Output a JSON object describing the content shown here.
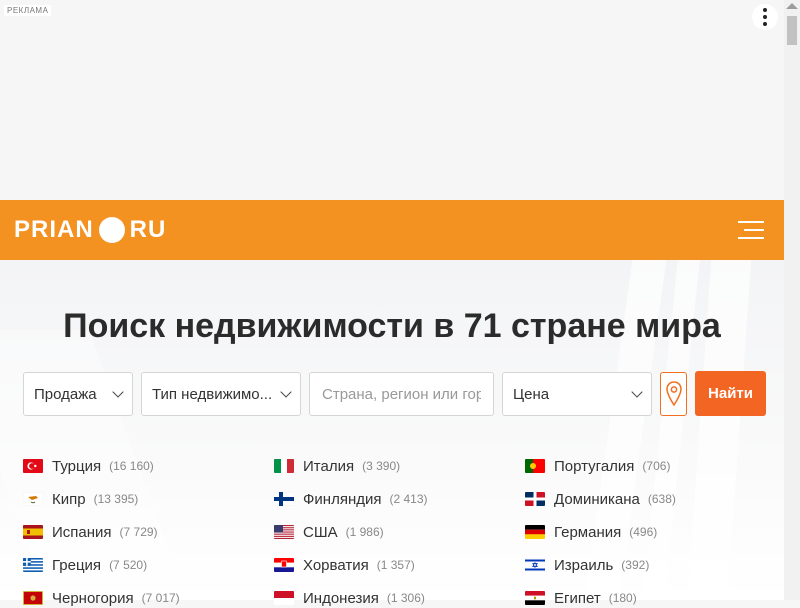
{
  "ad": {
    "label": "РЕКЛАМА"
  },
  "header": {
    "logo_left": "PRIAN",
    "logo_right": "RU"
  },
  "hero": {
    "title": "Поиск недвижимости в 71 стране мира"
  },
  "search": {
    "deal_type": "Продажа",
    "property_type": "Тип недвижимо...",
    "location_placeholder": "Страна, регион или город",
    "price": "Цена",
    "find_label": "Найти"
  },
  "countries": [
    {
      "name": "Турция",
      "count": "(16 160)",
      "flag": "turkey-flag-icon"
    },
    {
      "name": "Италия",
      "count": "(3 390)",
      "flag": "italy-flag-icon"
    },
    {
      "name": "Португалия",
      "count": "(706)",
      "flag": "portugal-flag-icon"
    },
    {
      "name": "Кипр",
      "count": "(13 395)",
      "flag": "cyprus-flag-icon"
    },
    {
      "name": "Финляндия",
      "count": "(2 413)",
      "flag": "finland-flag-icon"
    },
    {
      "name": "Доминикана",
      "count": "(638)",
      "flag": "dominican-flag-icon"
    },
    {
      "name": "Испания",
      "count": "(7 729)",
      "flag": "spain-flag-icon"
    },
    {
      "name": "США",
      "count": "(1 986)",
      "flag": "usa-flag-icon"
    },
    {
      "name": "Германия",
      "count": "(496)",
      "flag": "germany-flag-icon"
    },
    {
      "name": "Греция",
      "count": "(7 520)",
      "flag": "greece-flag-icon"
    },
    {
      "name": "Хорватия",
      "count": "(1 357)",
      "flag": "croatia-flag-icon"
    },
    {
      "name": "Израиль",
      "count": "(392)",
      "flag": "israel-flag-icon"
    },
    {
      "name": "Черногория",
      "count": "(7 017)",
      "flag": "montenegro-flag-icon"
    },
    {
      "name": "Индонезия",
      "count": "(1 306)",
      "flag": "indonesia-flag-icon"
    },
    {
      "name": "Египет",
      "count": "(180)",
      "flag": "egypt-flag-icon"
    }
  ],
  "colors": {
    "brand": "#f39121",
    "button": "#f26522"
  }
}
